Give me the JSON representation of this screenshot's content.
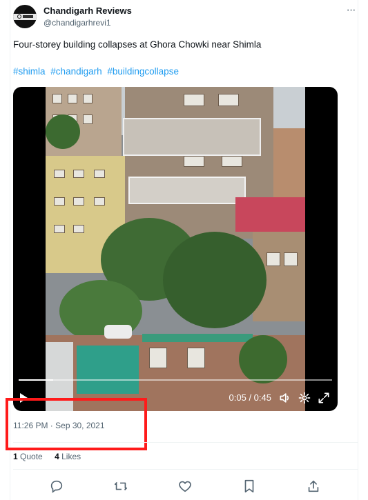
{
  "author": {
    "name": "Chandigarh Reviews",
    "handle": "@chandigarhrevi1",
    "avatar_icon": "chandigarh-reviews-logo"
  },
  "tweet": {
    "text": "Four-storey building collapses at Ghora Chowki near Shimla",
    "hashtags": [
      "#shimla",
      "#chandigarh",
      "#buildingcollapse"
    ]
  },
  "video": {
    "time": "0:05 / 0:45",
    "progress": 0.11,
    "icons": [
      "play-icon",
      "volume-icon",
      "settings-gear-icon",
      "fullscreen-icon"
    ]
  },
  "timestamp": "11:26 PM · Sep 30, 2021",
  "stats": {
    "quotes_count": "1",
    "quotes_label": "Quote",
    "likes_count": "4",
    "likes_label": "Likes"
  },
  "actions": [
    "reply-icon",
    "retweet-icon",
    "like-icon",
    "bookmark-icon",
    "share-icon"
  ],
  "colors": {
    "link": "#1d9bf0",
    "secondary_text": "#536471",
    "highlight_box": "#ff1a1a"
  }
}
